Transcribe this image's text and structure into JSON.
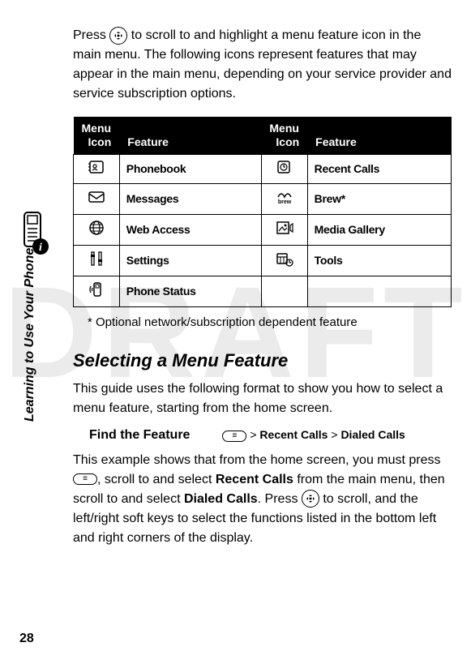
{
  "watermark": "DRAFT",
  "intro": {
    "pre": "Press ",
    "post": " to scroll to and highlight a menu feature icon in the main menu. The following icons represent features that may appear in the main menu, depending on your service provider and service subscription options."
  },
  "table": {
    "head_col1_l1": "Menu",
    "head_col1_l2": "Icon",
    "head_col2": "Feature",
    "head_col3_l1": "Menu",
    "head_col3_l2": "Icon",
    "head_col4": "Feature",
    "rows": [
      {
        "icon1": "phonebook-icon",
        "feat1": "Phonebook",
        "icon2": "recent-calls-icon",
        "feat2": "Recent Calls"
      },
      {
        "icon1": "messages-icon",
        "feat1": "Messages",
        "icon2": "brew-icon",
        "feat2": "Brew*"
      },
      {
        "icon1": "web-access-icon",
        "feat1": "Web Access",
        "icon2": "media-gallery-icon",
        "feat2": "Media Gallery"
      },
      {
        "icon1": "settings-icon",
        "feat1": "Settings",
        "icon2": "tools-icon",
        "feat2": "Tools"
      },
      {
        "icon1": "phone-status-icon",
        "feat1": "Phone Status",
        "icon2": "",
        "feat2": ""
      }
    ]
  },
  "footnote": "*   Optional network/subscription dependent feature",
  "section_heading": "Selecting a Menu Feature",
  "guide_intro": "This guide uses the following format to show you how to select a menu feature, starting from the home screen.",
  "find": {
    "label": "Find the Feature",
    "sep": ">",
    "p1": "Recent Calls",
    "p2": "Dialed Calls"
  },
  "example": {
    "t1": "This example shows that from the home screen, you must press ",
    "t2": ", scroll to and select  ",
    "t3": " from the main menu, then scroll to and select ",
    "t4": ". Press ",
    "t5": " to scroll, and the left/right soft keys to select the functions listed in the bottom left and right corners of the display.",
    "b1": "Recent Calls",
    "b2": "Dialed Calls"
  },
  "side_label": "Learning to Use Your Phone",
  "page_number": "28"
}
